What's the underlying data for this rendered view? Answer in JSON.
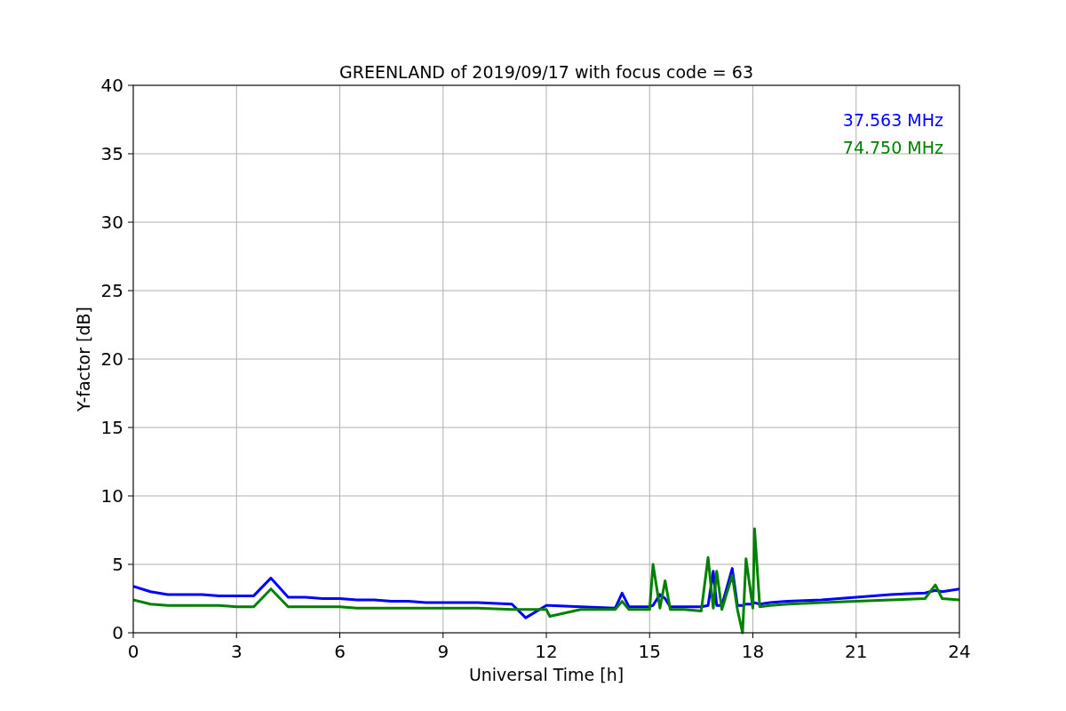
{
  "figure": {
    "chart_data": {
      "type": "line",
      "grid": true,
      "title": "GREENLAND of 2019/09/17 with focus code = 63",
      "xlabel": "Universal Time [h]",
      "ylabel": "Y-factor [dB]",
      "xlim": [
        0,
        24
      ],
      "ylim": [
        0,
        40
      ],
      "xticks": [
        0,
        3,
        6,
        9,
        12,
        15,
        18,
        21,
        24
      ],
      "yticks": [
        0,
        5,
        10,
        15,
        20,
        25,
        30,
        35,
        40
      ],
      "x": [
        0,
        0.5,
        1,
        1.5,
        2,
        2.5,
        3,
        3.5,
        4,
        4.5,
        5,
        5.5,
        6,
        6.5,
        7,
        7.5,
        8,
        8.5,
        9,
        10,
        11,
        11.4,
        12,
        12.1,
        13,
        14,
        14.2,
        14.4,
        15,
        15.1,
        15.3,
        15.45,
        15.6,
        16,
        16.5,
        16.7,
        16.85,
        16.95,
        17.1,
        17.4,
        17.55,
        17.7,
        17.8,
        18,
        18.05,
        18.2,
        18.5,
        19,
        20,
        21,
        22,
        23,
        23.3,
        23.5,
        24
      ],
      "series": [
        {
          "name": "37.563 MHz",
          "color": "#0000ff",
          "values": [
            3.4,
            3.0,
            2.8,
            2.8,
            2.8,
            2.7,
            2.7,
            2.7,
            4.0,
            2.6,
            2.6,
            2.5,
            2.5,
            2.4,
            2.4,
            2.3,
            2.3,
            2.2,
            2.2,
            2.2,
            2.1,
            1.1,
            2.0,
            2.0,
            1.9,
            1.8,
            2.9,
            1.9,
            1.9,
            2.0,
            2.8,
            2.5,
            1.9,
            1.9,
            1.9,
            2.0,
            4.5,
            2.0,
            2.0,
            4.7,
            2.0,
            2.0,
            2.1,
            2.1,
            2.2,
            2.1,
            2.2,
            2.3,
            2.4,
            2.6,
            2.8,
            2.9,
            3.1,
            3.0,
            3.2
          ]
        },
        {
          "name": "74.750 MHz",
          "color": "#008000",
          "values": [
            2.4,
            2.1,
            2.0,
            2.0,
            2.0,
            2.0,
            1.9,
            1.9,
            3.2,
            1.9,
            1.9,
            1.9,
            1.9,
            1.8,
            1.8,
            1.8,
            1.8,
            1.8,
            1.8,
            1.8,
            1.7,
            1.7,
            1.7,
            1.2,
            1.7,
            1.7,
            2.3,
            1.7,
            1.7,
            5.0,
            1.8,
            3.8,
            1.7,
            1.7,
            1.6,
            5.5,
            1.8,
            4.5,
            1.7,
            4.2,
            1.7,
            0,
            5.4,
            1.8,
            7.6,
            1.9,
            2.0,
            2.1,
            2.2,
            2.3,
            2.4,
            2.5,
            3.5,
            2.5,
            2.4
          ]
        }
      ]
    }
  }
}
